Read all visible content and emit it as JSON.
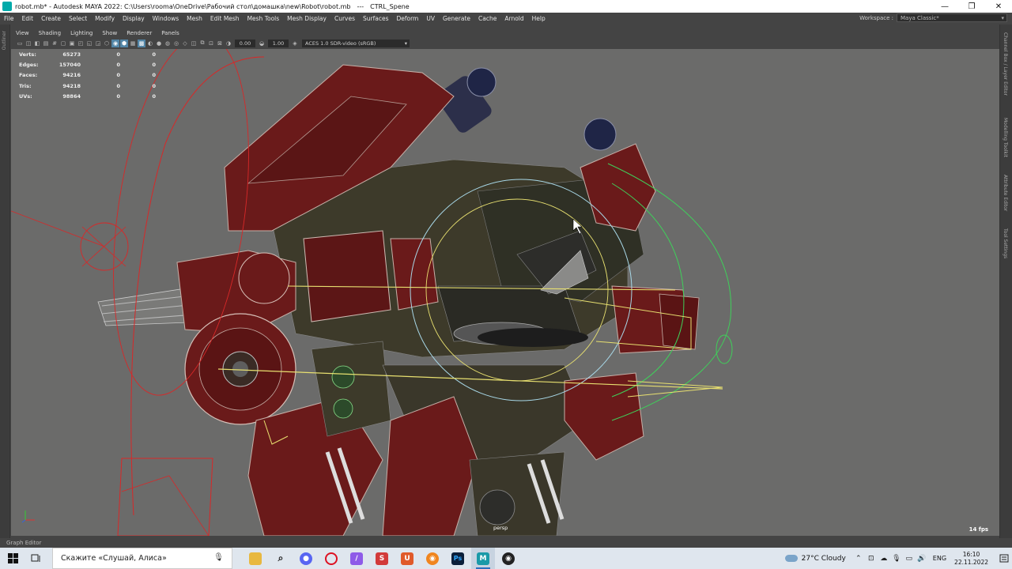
{
  "window": {
    "title": "robot.mb* - Autodesk MAYA 2022: C:\\Users\\rooma\\OneDrive\\Рабочий стол\\домашка\\new\\Robot\\robot.mb",
    "separator": "---",
    "scene": "CTRL_Spene",
    "minimize": "—",
    "restore": "❐",
    "close": "✕"
  },
  "menubar": [
    "File",
    "Edit",
    "Create",
    "Select",
    "Modify",
    "Display",
    "Windows",
    "Mesh",
    "Edit Mesh",
    "Mesh Tools",
    "Mesh Display",
    "Curves",
    "Surfaces",
    "Deform",
    "UV",
    "Generate",
    "Cache",
    "Arnold",
    "Help"
  ],
  "workspace": {
    "label": "Workspace :",
    "value": "Maya Classic*"
  },
  "left_panel_label": "Outliner",
  "right_tabs": [
    "Channel Box / Layer Editor",
    "Modelling Toolkit",
    "Attribute Editor",
    "Tool Settings"
  ],
  "panel_menu": [
    "View",
    "Shading",
    "Lighting",
    "Show",
    "Renderer",
    "Panels"
  ],
  "toolbar": {
    "exposure": "0.00",
    "gamma": "1.00",
    "colorspace": "ACES 1.0 SDR-video (sRGB)"
  },
  "hud": [
    {
      "label": "Verts:",
      "value": "65273",
      "a": "0",
      "b": "0"
    },
    {
      "label": "Edges:",
      "value": "157040",
      "a": "0",
      "b": "0"
    },
    {
      "label": "Faces:",
      "value": "94216",
      "a": "0",
      "b": "0"
    },
    {
      "label": "Tris:",
      "value": "94218",
      "a": "0",
      "b": "0"
    },
    {
      "label": "UVs:",
      "value": "98864",
      "a": "0",
      "b": "0"
    }
  ],
  "camera": "persp",
  "fps": "14 fps",
  "graph_editor": "Graph Editor",
  "taskbar": {
    "search_text": "Скажите «Слушай, Алиса»",
    "weather": "27°C  Cloudy",
    "lang": "ENG",
    "time": "16:10",
    "date": "22.11.2022"
  },
  "colors": {
    "accent": "#5285a6",
    "viewport": "#6b6b6a",
    "rig_red": "#d82828",
    "rig_green": "#3fcf5a",
    "rig_yellow": "#e8e070",
    "rig_cyan": "#a8d8e8"
  }
}
